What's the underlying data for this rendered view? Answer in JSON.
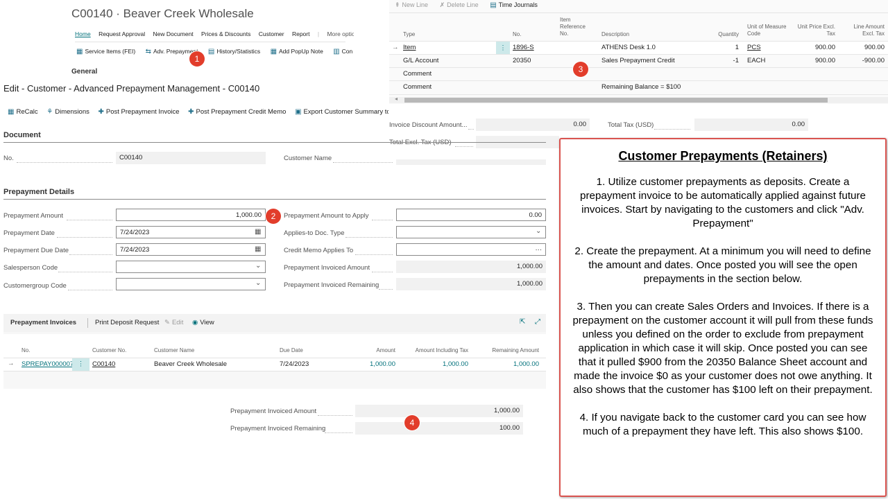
{
  "customer_card": {
    "title": "C00140 · Beaver Creek Wholesale",
    "menu": [
      "Home",
      "Request Approval",
      "New Document",
      "Prices & Discounts",
      "Customer",
      "Report",
      "More options"
    ],
    "actions": [
      "Service Items (FEI)",
      "Adv. Prepayment",
      "History/Statistics",
      "Add PopUp Note",
      "Con"
    ],
    "section": "General"
  },
  "lines_panel": {
    "toolbar": {
      "new_line": "New Line",
      "delete_line": "Delete Line",
      "time_journals": "Time Journals"
    },
    "columns": [
      "Type",
      "No.",
      "Item Reference No.",
      "Description",
      "Quantity",
      "Unit of Measure Code",
      "Unit Price Excl. Tax",
      "Line Amount Excl. Tax"
    ],
    "rows": [
      {
        "type": "Item",
        "no": "1896-S",
        "desc": "ATHENS Desk 1.0",
        "qty": "1",
        "uom": "PCS",
        "price": "900.00",
        "amount": "900.00"
      },
      {
        "type": "G/L Account",
        "no": "20350",
        "desc": "Sales Prepayment Credit",
        "qty": "-1",
        "uom": "EACH",
        "price": "900.00",
        "amount": "-900.00"
      },
      {
        "type": "Comment",
        "no": "",
        "desc": "",
        "qty": "",
        "uom": "",
        "price": "",
        "amount": ""
      },
      {
        "type": "Comment",
        "no": "",
        "desc": "Remaining Balance =  $100",
        "qty": "",
        "uom": "",
        "price": "",
        "amount": ""
      }
    ],
    "totals": {
      "inv_disc_label": "Invoice Discount Amount...",
      "inv_disc_value": "0.00",
      "total_tax_label": "Total Tax (USD)",
      "total_tax_value": "0.00",
      "total_excl_label": "Total Excl. Tax (USD)"
    }
  },
  "prepay_page": {
    "title": "Edit - Customer - Advanced Prepayment Management - C00140",
    "actions": [
      "ReCalc",
      "Dimensions",
      "Post Prepayment Invoice",
      "Post Prepayment Credit Memo",
      "Export Customer Summary to Ex"
    ],
    "document_section": "Document",
    "no_label": "No.",
    "no_value": "C00140",
    "customer_name_label": "Customer Name",
    "details_section": "Prepayment Details",
    "left_fields": [
      {
        "label": "Prepayment Amount",
        "value": "1,000.00"
      },
      {
        "label": "Prepayment Date",
        "value": "7/24/2023"
      },
      {
        "label": "Prepayment Due Date",
        "value": "7/24/2023"
      },
      {
        "label": "Salesperson Code",
        "value": ""
      },
      {
        "label": "Customergroup Code",
        "value": ""
      }
    ],
    "right_fields": [
      {
        "label": "Prepayment Amount to Apply",
        "value": "0.00"
      },
      {
        "label": "Applies-to Doc. Type",
        "value": ""
      },
      {
        "label": "Credit Memo Applies To",
        "value": "···"
      },
      {
        "label": "Prepayment Invoiced Amount",
        "value": "1,000.00"
      },
      {
        "label": "Prepayment Invoiced Remaining",
        "value": "1,000.00"
      }
    ],
    "invoices": {
      "tab": "Prepayment Invoices",
      "print": "Print Deposit Request",
      "edit": "Edit",
      "view": "View",
      "columns": [
        "No.",
        "Customer No.",
        "Customer Name",
        "Due Date",
        "Amount",
        "Amount Including Tax",
        "Remaining Amount"
      ],
      "row": {
        "no": "SPREPAY000007",
        "customer_no": "C00140",
        "customer_name": "Beaver Creek Wholesale",
        "due_date": "7/24/2023",
        "amount": "1,000.00",
        "amount_incl": "1,000.00",
        "remaining": "1,000.00"
      }
    }
  },
  "bottom_summary": {
    "invoiced_label": "Prepayment Invoiced Amount",
    "invoiced_value": "1,000.00",
    "remaining_label": "Prepayment Invoiced Remaining",
    "remaining_value": "100.00"
  },
  "badges": {
    "b1": "1",
    "b2": "2",
    "b3": "3",
    "b4": "4"
  },
  "callout": {
    "title": "Customer Prepayments (Retainers)",
    "p1": "1. Utilize customer prepayments as deposits. Create a prepayment invoice to be automatically applied against future invoices. Start by navigating to the customers and click \"Adv. Prepayment\"",
    "p2": "2. Create the prepayment. At a minimum you will need to define the amount and dates. Once posted you will see the open prepayments in the section below.",
    "p3": "3. Then you can create Sales Orders and Invoices. If there is a prepayment on the customer account it will pull from these funds unless you defined on the order to exclude from prepayment application in which case it will skip. Once posted you can see that it pulled $900 from the 20350 Balance Sheet account and made the invoice $0 as your customer does not owe anything. It also shows that the customer has $100 left on their prepayment.",
    "p4": "4. If you navigate back to the customer card you can see how much of a prepayment they have left. This also shows $100."
  },
  "colors": {
    "accent": "#00707a",
    "badge": "#e23d2b",
    "callout_border": "#d9534f"
  }
}
